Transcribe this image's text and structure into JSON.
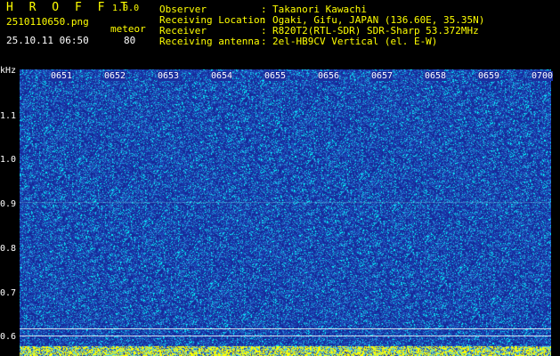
{
  "header": {
    "app_name": "H R O F F T",
    "version": "1.0.0",
    "filename": "2510110650.png",
    "mode": "meteor",
    "datetime": "25.10.11 06:50",
    "count": "80"
  },
  "station": {
    "rows": [
      {
        "label": "Observer",
        "sep": ":",
        "value": "Takanori Kawachi"
      },
      {
        "label": "Receiving Location",
        "sep": ":",
        "value": "Ogaki, Gifu, JAPAN (136.60E, 35.35N)"
      },
      {
        "label": "Receiver",
        "sep": ":",
        "value": "R820T2(RTL-SDR) SDR-Sharp 53.372MHz"
      },
      {
        "label": "Receiving antenna",
        "sep": ":",
        "value": "2el-HB9CV Vertical (el. E-W)"
      }
    ]
  },
  "spectrogram": {
    "y_unit": "kHz",
    "y_ticks": [
      "1.1",
      "1.0",
      "0.9",
      "0.8",
      "0.7",
      "0.6"
    ],
    "x_ticks": [
      "0651",
      "0652",
      "0653",
      "0654",
      "0655",
      "0656",
      "0657",
      "0658",
      "0659",
      "0700"
    ],
    "colors": {
      "background": "#000000",
      "low": "#1a2a9a",
      "mid": "#2f8cd6",
      "high": "#00ffff",
      "peak": "#ffff00"
    }
  }
}
